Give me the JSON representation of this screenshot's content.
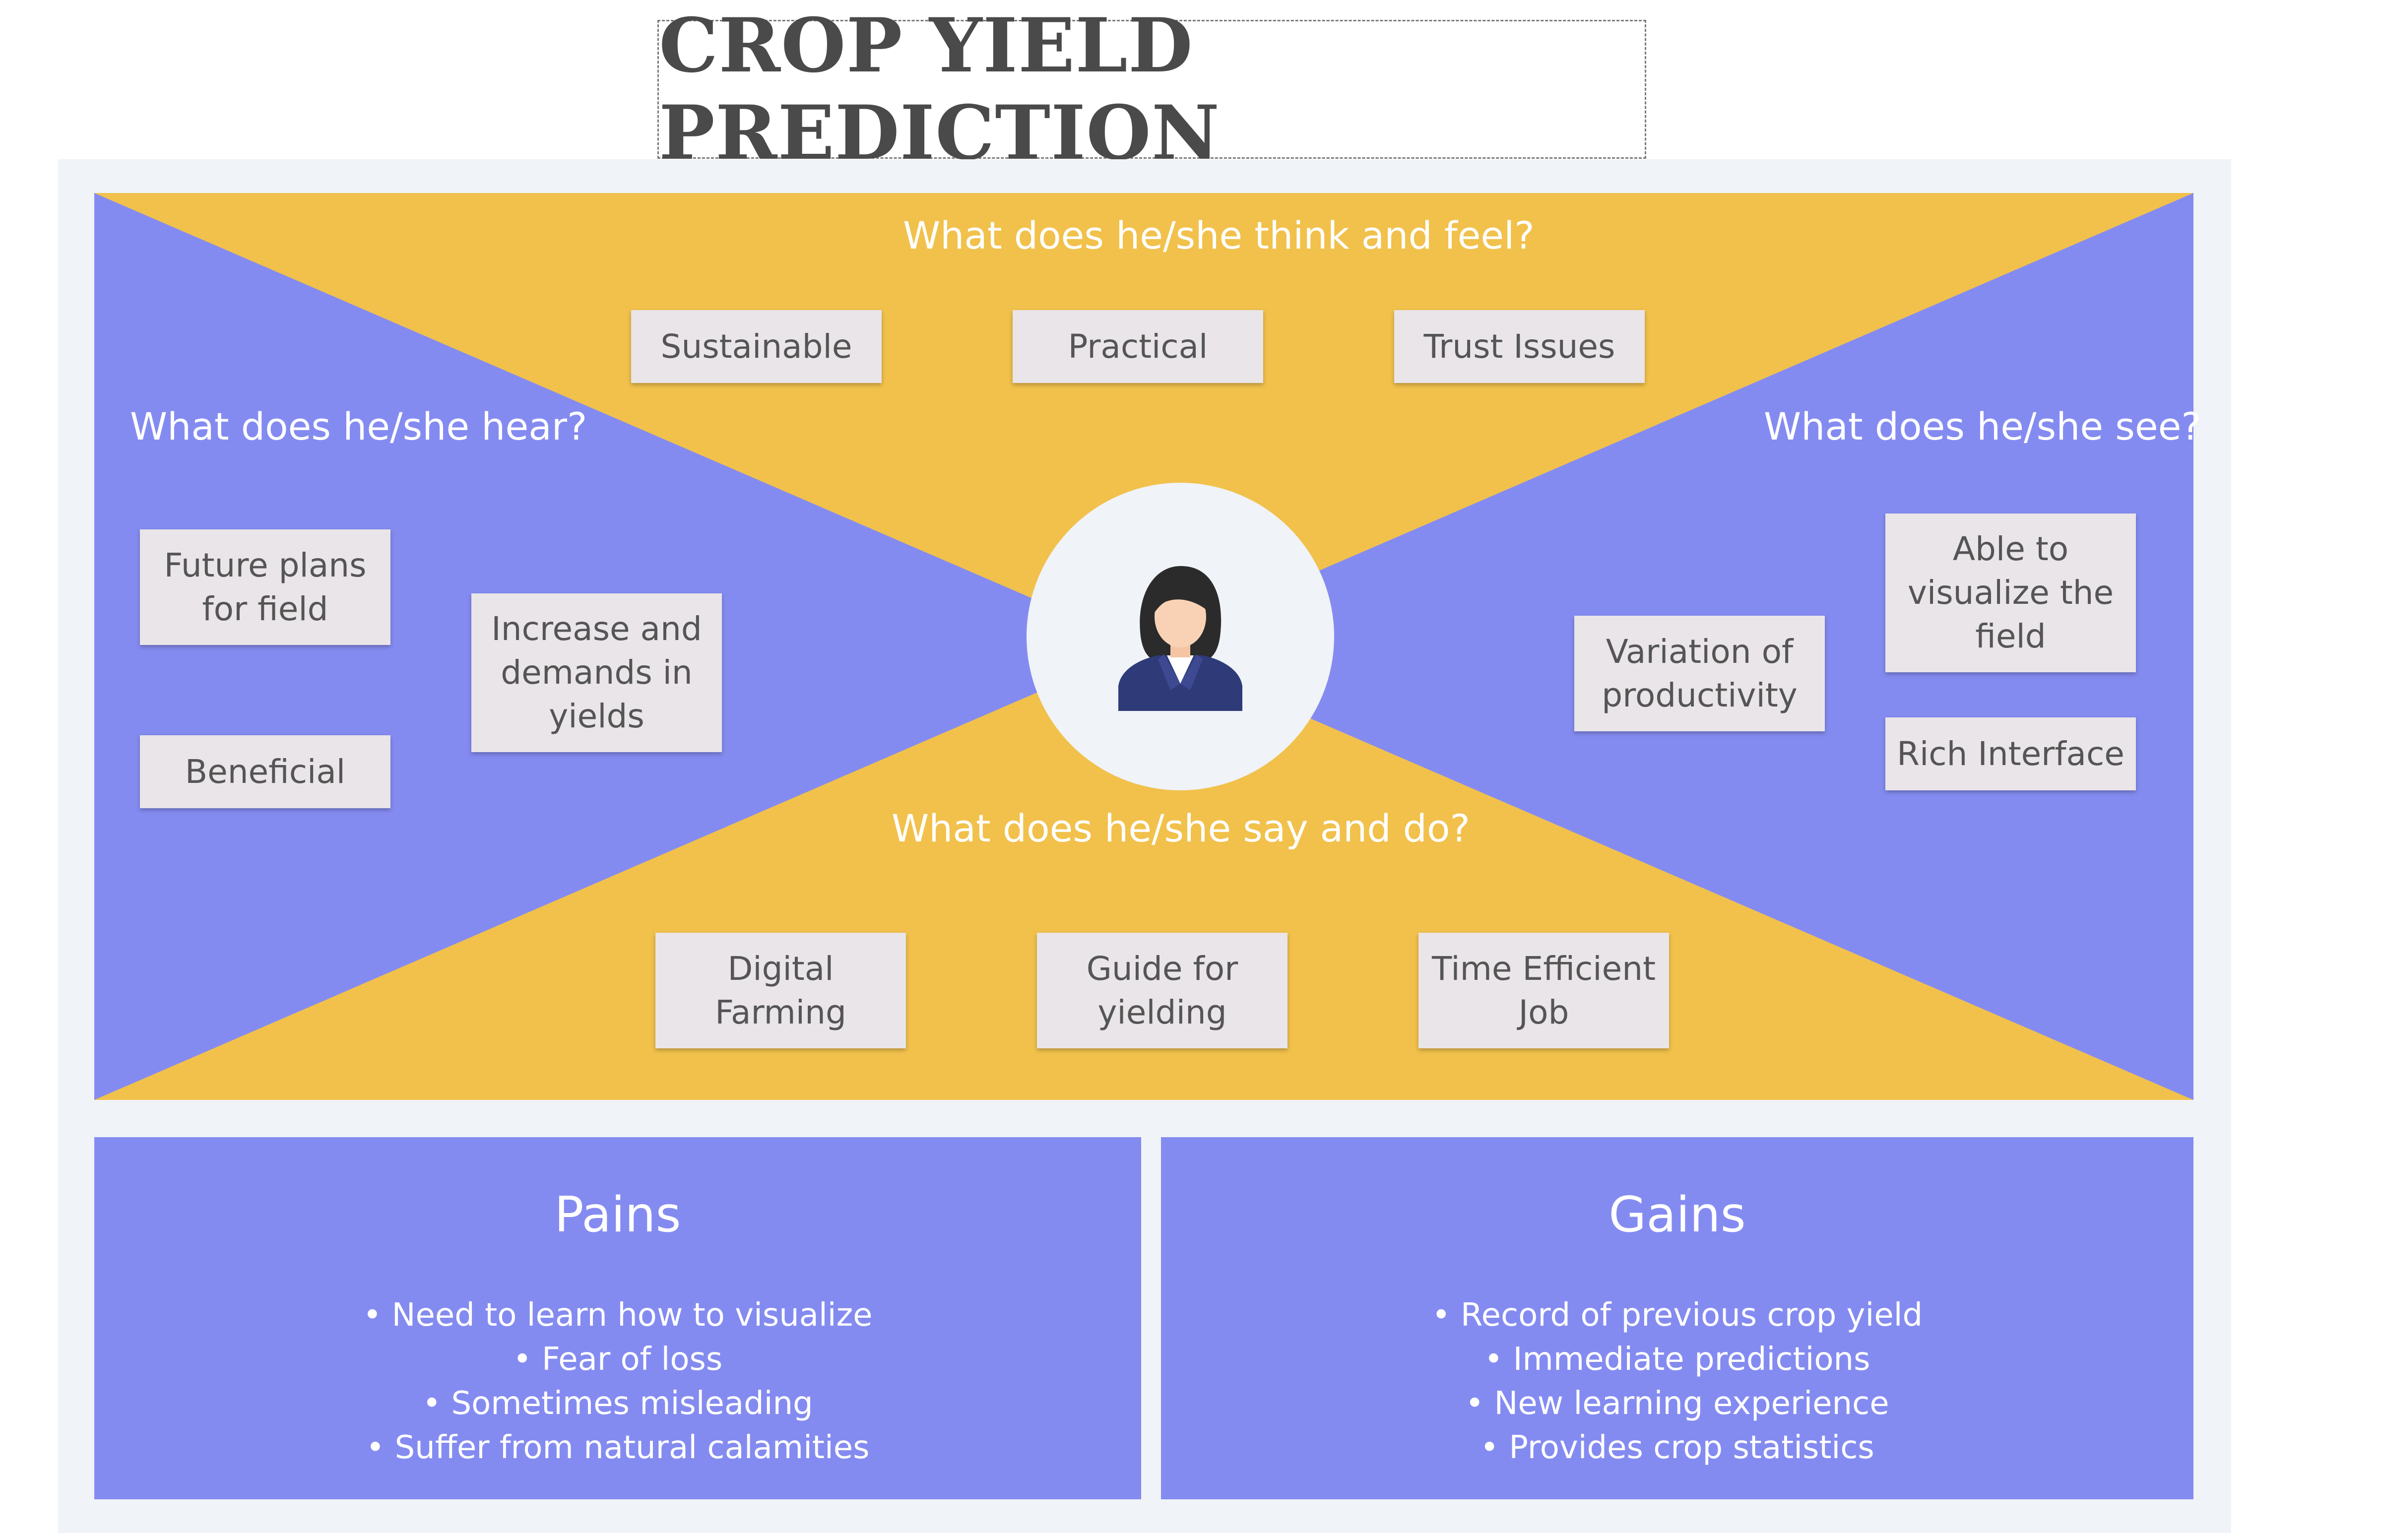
{
  "title": "CROP YIELD PREDICTION",
  "colors": {
    "yellow": "#f1c14c",
    "purple": "#848bf0",
    "panel": "#f0f3f7",
    "sticky": "#e9e5e8"
  },
  "think_feel": {
    "question": "What does he/she think and feel?",
    "notes": [
      "Sustainable",
      "Practical",
      "Trust Issues"
    ]
  },
  "hear": {
    "question": "What does he/she hear?",
    "notes": [
      "Future plans for field",
      "Increase and demands in yields",
      "Beneficial"
    ]
  },
  "see": {
    "question": "What does he/she see?",
    "notes": [
      "Able to visualize the field",
      "Variation of productivity",
      "Rich Interface"
    ]
  },
  "say_do": {
    "question": "What does he/she say and do?",
    "notes": [
      "Digital Farming",
      "Guide for yielding",
      "Time Efficient Job"
    ]
  },
  "persona": {
    "icon": "woman-avatar-icon"
  },
  "pains": {
    "title": "Pains",
    "items": [
      "• Need to learn how to visualize",
      "• Fear of loss",
      "• Sometimes misleading",
      "• Suffer from natural calamities"
    ]
  },
  "gains": {
    "title": "Gains",
    "items": [
      "• Record of previous crop yield",
      "• Immediate predictions",
      "• New learning experience",
      "• Provides crop statistics"
    ]
  }
}
